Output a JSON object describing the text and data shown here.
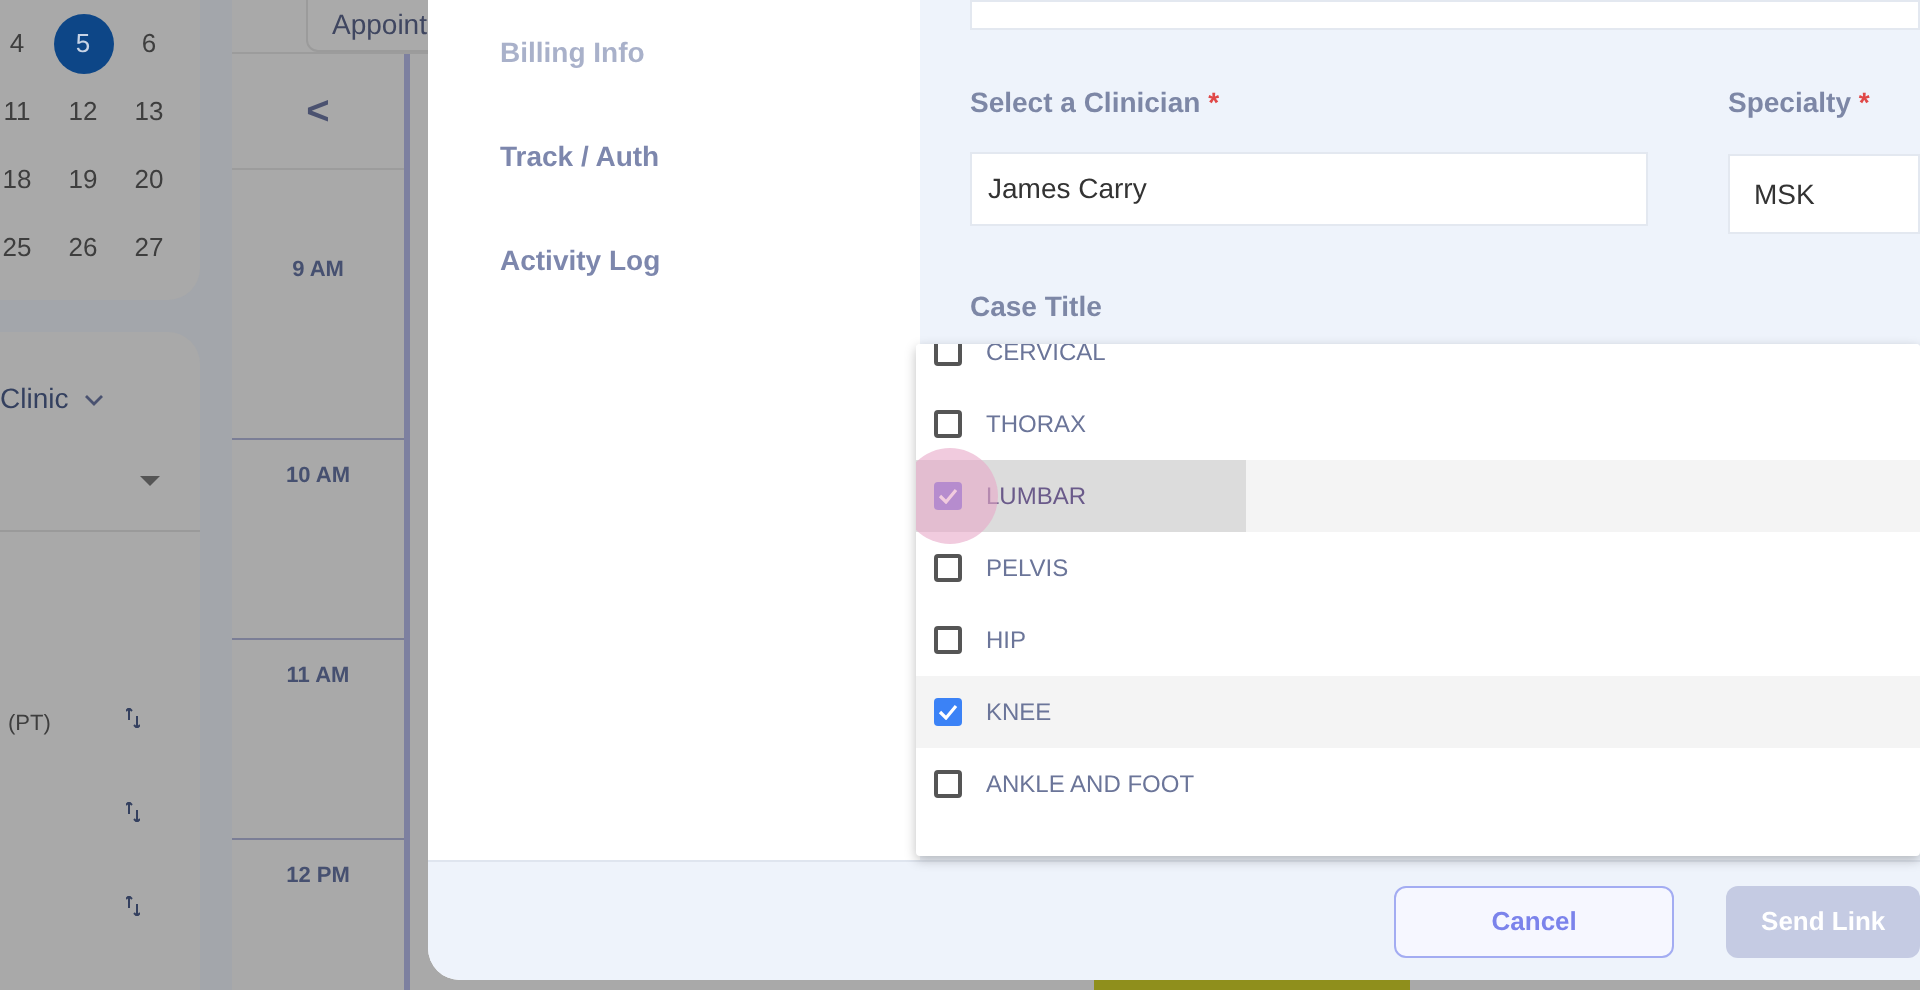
{
  "calendar": {
    "weeks": [
      [
        {
          "day": "4",
          "selected": false
        },
        {
          "day": "5",
          "selected": true
        },
        {
          "day": "6",
          "selected": false
        }
      ],
      [
        {
          "day": "11",
          "selected": false
        },
        {
          "day": "12",
          "selected": false
        },
        {
          "day": "13",
          "selected": false
        }
      ],
      [
        {
          "day": "18",
          "selected": false
        },
        {
          "day": "19",
          "selected": false
        },
        {
          "day": "20",
          "selected": false
        }
      ],
      [
        {
          "day": "25",
          "selected": false
        },
        {
          "day": "26",
          "selected": false
        },
        {
          "day": "27",
          "selected": false
        }
      ]
    ]
  },
  "clinic_panel": {
    "title": "Clinic",
    "rows": [
      {
        "label": "(PT)"
      },
      {},
      {}
    ]
  },
  "schedule": {
    "view_button": "Appoint",
    "prev": "<",
    "times": [
      "9 AM",
      "10 AM",
      "11 AM",
      "12 PM"
    ]
  },
  "modal": {
    "nav": [
      {
        "label": "Billing Info",
        "disabled": true
      },
      {
        "label": "Track / Auth",
        "disabled": false
      },
      {
        "label": "Activity Log",
        "disabled": false
      }
    ],
    "clinician": {
      "label": "Select a Clinician",
      "required_mark": "*",
      "value": "James Carry"
    },
    "specialty": {
      "label": "Specialty",
      "required_mark": "*",
      "value": "MSK"
    },
    "case_title": {
      "label": "Case Title"
    },
    "options": [
      {
        "label": "CERVICAL",
        "checked": false,
        "focused": false
      },
      {
        "label": "THORAX",
        "checked": false,
        "focused": false
      },
      {
        "label": "LUMBAR",
        "checked": true,
        "focused": true
      },
      {
        "label": "PELVIS",
        "checked": false,
        "focused": false
      },
      {
        "label": "HIP",
        "checked": false,
        "focused": false
      },
      {
        "label": "KNEE",
        "checked": true,
        "focused": false
      },
      {
        "label": "ANKLE AND FOOT",
        "checked": false,
        "focused": false
      }
    ],
    "buttons": [
      {
        "label": "Cancel",
        "kind": "secondary"
      },
      {
        "label": "Send Link",
        "kind": "primary"
      }
    ]
  }
}
